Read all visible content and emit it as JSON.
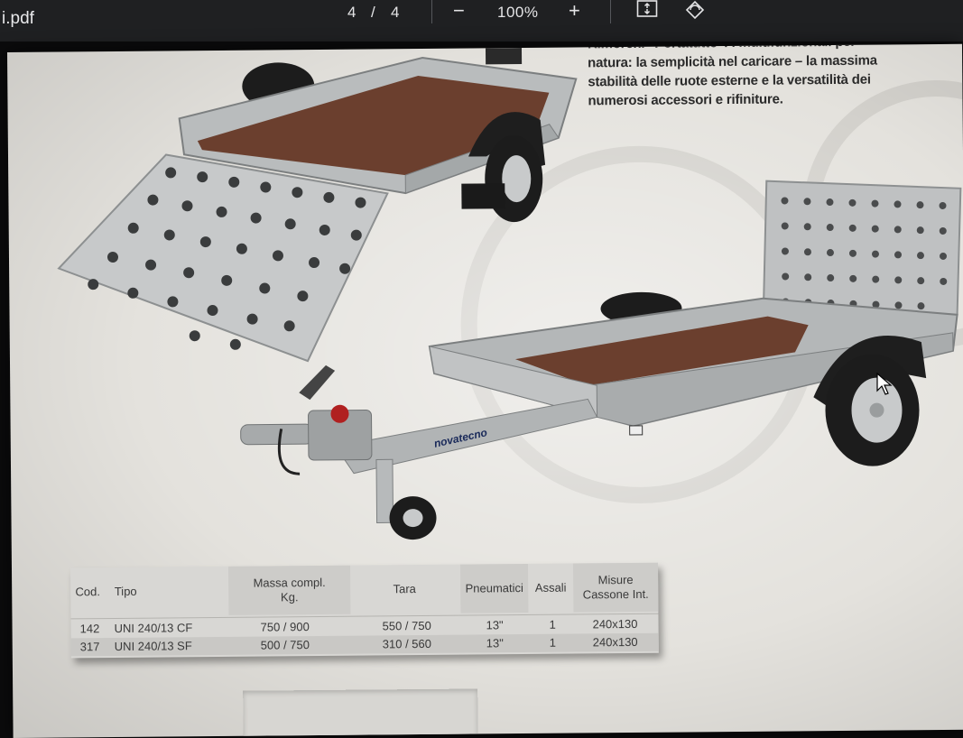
{
  "toolbar": {
    "file_name": "i.pdf",
    "page_current": "4",
    "page_separator": "/",
    "page_total": "4",
    "zoom_out_label": "−",
    "zoom_level": "100%",
    "zoom_in_label": "+",
    "fit_icon": "fit-page-icon",
    "rotate_icon": "rotate-icon"
  },
  "page": {
    "intro_lines": [
      "Rimorchi \"Portatutto\": i multifunzionali per",
      "natura: la semplicità nel caricare – la massima",
      "stabilità delle ruote esterne e la versatilità dei",
      "numerosi accessori e rifiniture."
    ],
    "brand_label": "novatecno",
    "spec_table": {
      "headers": {
        "cod": "Cod.",
        "tipo": "Tipo",
        "massa_line1": "Massa compl.",
        "massa_line2": "Kg.",
        "tara": "Tara",
        "pneumatici": "Pneumatici",
        "assali": "Assali",
        "misure_line1": "Misure",
        "misure_line2": "Cassone Int."
      },
      "rows": [
        {
          "cod": "142",
          "tipo": "UNI 240/13 CF",
          "massa": "750 / 900",
          "tara": "550 / 750",
          "pneumatici": "13\"",
          "assali": "1",
          "misure": "240x130"
        },
        {
          "cod": "317",
          "tipo": "UNI 240/13 SF",
          "massa": "500 / 750",
          "tara": "310 / 560",
          "pneumatici": "13\"",
          "assali": "1",
          "misure": "240x130"
        }
      ]
    }
  },
  "colors": {
    "toolbar_bg": "#1f2022",
    "page_bg": "#e4e2dd",
    "trailer_metal": "#b9bcbd",
    "trailer_floor": "#6b3f2e",
    "tire": "#1c1c1c",
    "table_bg": "#d8d7d4"
  }
}
